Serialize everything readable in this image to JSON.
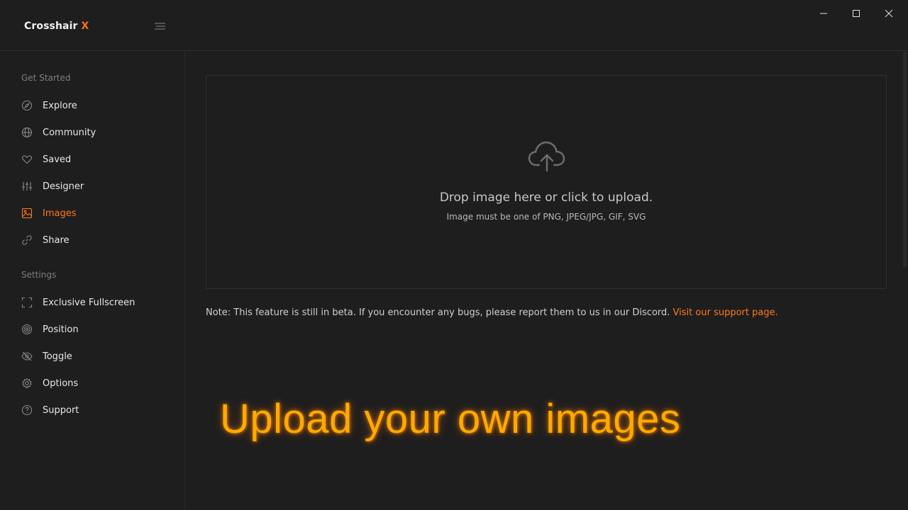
{
  "app": {
    "brand_main": "Crosshair",
    "brand_accent": "X"
  },
  "window_controls": {
    "minimize_icon": "minimize-icon",
    "maximize_icon": "maximize-icon",
    "close_icon": "close-icon"
  },
  "sidebar": {
    "section_get_started": "Get Started",
    "section_settings": "Settings",
    "items": [
      {
        "label": "Explore",
        "icon": "compass-icon"
      },
      {
        "label": "Community",
        "icon": "globe-icon"
      },
      {
        "label": "Saved",
        "icon": "heart-icon"
      },
      {
        "label": "Designer",
        "icon": "sliders-icon"
      },
      {
        "label": "Images",
        "icon": "image-icon",
        "active": true
      },
      {
        "label": "Share",
        "icon": "link-icon"
      },
      {
        "label": "Exclusive Fullscreen",
        "icon": "fullscreen-icon"
      },
      {
        "label": "Position",
        "icon": "target-icon"
      },
      {
        "label": "Toggle",
        "icon": "eye-off-icon"
      },
      {
        "label": "Options",
        "icon": "gear-icon"
      },
      {
        "label": "Support",
        "icon": "help-circle-icon"
      }
    ]
  },
  "upload": {
    "icon": "cloud-upload-icon",
    "title": "Drop image here or click to upload.",
    "subtitle": "Image must be one of PNG, JPEG/JPG, GIF, SVG"
  },
  "note": {
    "text": "Note: This feature is still in beta. If you encounter any bugs, please report them to us in our Discord. ",
    "link": "Visit our support page."
  },
  "promo": {
    "text": "Upload your own images"
  },
  "colors": {
    "accent": "#ff7a1a",
    "background": "#1e1e1e",
    "promo": "#ffaa00"
  }
}
